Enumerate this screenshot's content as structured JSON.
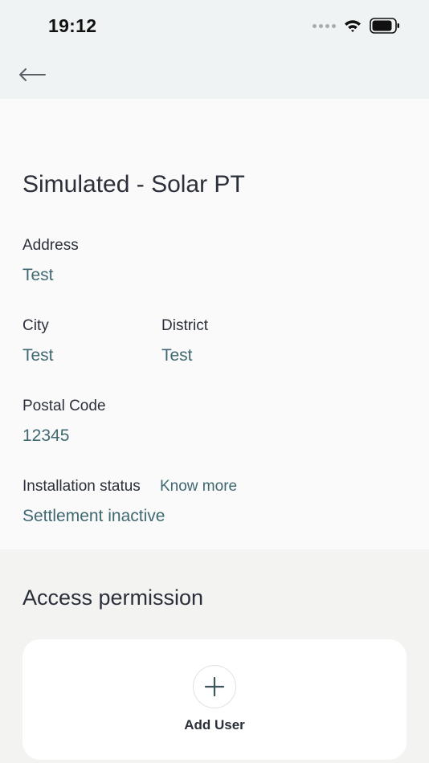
{
  "status_bar": {
    "time": "19:12"
  },
  "site": {
    "title": "Simulated - Solar PT",
    "address_label": "Address",
    "address_value": "Test",
    "city_label": "City",
    "city_value": "Test",
    "district_label": "District",
    "district_value": "Test",
    "postal_label": "Postal Code",
    "postal_value": "12345",
    "status_label": "Installation status",
    "know_more": "Know more",
    "status_value": "Settlement inactive"
  },
  "access": {
    "title": "Access permission",
    "add_user_label": "Add User"
  },
  "colors": {
    "header_bg": "#eff3f4",
    "value_text": "#3f6870",
    "text": "#2a2f3a"
  },
  "icons": [
    "wifi-icon",
    "battery-icon",
    "back-arrow-icon",
    "plus-icon"
  ]
}
